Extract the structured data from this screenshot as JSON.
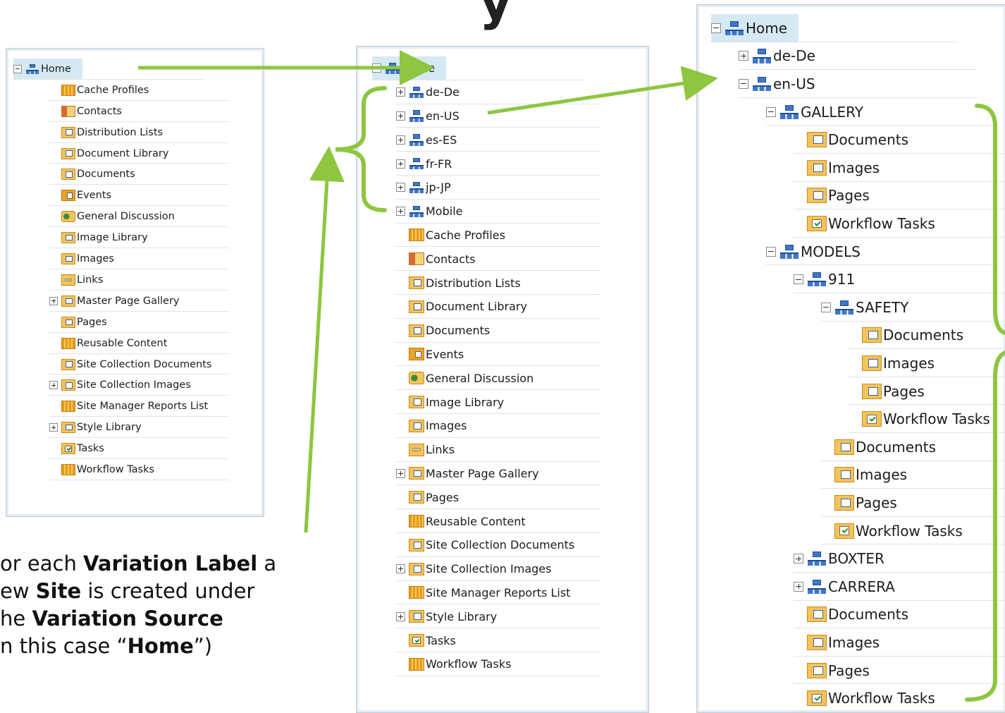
{
  "panel1": {
    "items": [
      {
        "label": "Home",
        "toggle": "minus",
        "icon": "site",
        "depth": 0,
        "selected": true
      },
      {
        "label": "Cache Profiles",
        "toggle": "none",
        "icon": "list",
        "depth": 1
      },
      {
        "label": "Contacts",
        "toggle": "none",
        "icon": "contacts",
        "depth": 1
      },
      {
        "label": "Distribution Lists",
        "toggle": "none",
        "icon": "doc",
        "depth": 1
      },
      {
        "label": "Document Library",
        "toggle": "none",
        "icon": "doc",
        "depth": 1
      },
      {
        "label": "Documents",
        "toggle": "none",
        "icon": "doc",
        "depth": 1
      },
      {
        "label": "Events",
        "toggle": "none",
        "icon": "events",
        "depth": 1
      },
      {
        "label": "General Discussion",
        "toggle": "none",
        "icon": "disc",
        "depth": 1
      },
      {
        "label": "Image Library",
        "toggle": "none",
        "icon": "doc",
        "depth": 1
      },
      {
        "label": "Images",
        "toggle": "none",
        "icon": "doc",
        "depth": 1
      },
      {
        "label": "Links",
        "toggle": "none",
        "icon": "links",
        "depth": 1
      },
      {
        "label": "Master Page Gallery",
        "toggle": "plus",
        "icon": "doc",
        "depth": 1
      },
      {
        "label": "Pages",
        "toggle": "none",
        "icon": "doc",
        "depth": 1
      },
      {
        "label": "Reusable Content",
        "toggle": "none",
        "icon": "list",
        "depth": 1
      },
      {
        "label": "Site Collection Documents",
        "toggle": "none",
        "icon": "doc",
        "depth": 1
      },
      {
        "label": "Site Collection Images",
        "toggle": "plus",
        "icon": "doc",
        "depth": 1
      },
      {
        "label": "Site Manager Reports List",
        "toggle": "none",
        "icon": "list",
        "depth": 1
      },
      {
        "label": "Style Library",
        "toggle": "plus",
        "icon": "doc",
        "depth": 1
      },
      {
        "label": "Tasks",
        "toggle": "none",
        "icon": "task",
        "depth": 1
      },
      {
        "label": "Workflow Tasks",
        "toggle": "none",
        "icon": "list",
        "depth": 1
      }
    ]
  },
  "panel2": {
    "items": [
      {
        "label": "Home",
        "toggle": "minus",
        "icon": "site",
        "depth": 0,
        "selected": true
      },
      {
        "label": "de-De",
        "toggle": "plus",
        "icon": "site",
        "depth": 1
      },
      {
        "label": "en-US",
        "toggle": "plus",
        "icon": "site",
        "depth": 1
      },
      {
        "label": "es-ES",
        "toggle": "plus",
        "icon": "site",
        "depth": 1
      },
      {
        "label": "fr-FR",
        "toggle": "plus",
        "icon": "site",
        "depth": 1
      },
      {
        "label": "jp-JP",
        "toggle": "plus",
        "icon": "site",
        "depth": 1
      },
      {
        "label": "Mobile",
        "toggle": "plus",
        "icon": "site",
        "depth": 1
      },
      {
        "label": "Cache Profiles",
        "toggle": "none",
        "icon": "list",
        "depth": 1
      },
      {
        "label": "Contacts",
        "toggle": "none",
        "icon": "contacts",
        "depth": 1
      },
      {
        "label": "Distribution Lists",
        "toggle": "none",
        "icon": "doc",
        "depth": 1
      },
      {
        "label": "Document Library",
        "toggle": "none",
        "icon": "doc",
        "depth": 1
      },
      {
        "label": "Documents",
        "toggle": "none",
        "icon": "doc",
        "depth": 1
      },
      {
        "label": "Events",
        "toggle": "none",
        "icon": "events",
        "depth": 1
      },
      {
        "label": "General Discussion",
        "toggle": "none",
        "icon": "disc",
        "depth": 1
      },
      {
        "label": "Image Library",
        "toggle": "none",
        "icon": "doc",
        "depth": 1
      },
      {
        "label": "Images",
        "toggle": "none",
        "icon": "doc",
        "depth": 1
      },
      {
        "label": "Links",
        "toggle": "none",
        "icon": "links",
        "depth": 1
      },
      {
        "label": "Master Page Gallery",
        "toggle": "plus",
        "icon": "doc",
        "depth": 1
      },
      {
        "label": "Pages",
        "toggle": "none",
        "icon": "doc",
        "depth": 1
      },
      {
        "label": "Reusable Content",
        "toggle": "none",
        "icon": "list",
        "depth": 1
      },
      {
        "label": "Site Collection Documents",
        "toggle": "none",
        "icon": "doc",
        "depth": 1
      },
      {
        "label": "Site Collection Images",
        "toggle": "plus",
        "icon": "doc",
        "depth": 1
      },
      {
        "label": "Site Manager Reports List",
        "toggle": "none",
        "icon": "list",
        "depth": 1
      },
      {
        "label": "Style Library",
        "toggle": "plus",
        "icon": "doc",
        "depth": 1
      },
      {
        "label": "Tasks",
        "toggle": "none",
        "icon": "task",
        "depth": 1
      },
      {
        "label": "Workflow Tasks",
        "toggle": "none",
        "icon": "list",
        "depth": 1
      }
    ]
  },
  "panel3": {
    "items": [
      {
        "label": "Home",
        "toggle": "minus",
        "icon": "site",
        "depth": 0,
        "selected": true
      },
      {
        "label": "de-De",
        "toggle": "plus",
        "icon": "site",
        "depth": 1
      },
      {
        "label": "en-US",
        "toggle": "minus",
        "icon": "site",
        "depth": 1
      },
      {
        "label": "GALLERY",
        "toggle": "minus",
        "icon": "site",
        "depth": 2
      },
      {
        "label": "Documents",
        "toggle": "none",
        "icon": "doc",
        "depth": 3
      },
      {
        "label": "Images",
        "toggle": "none",
        "icon": "doc",
        "depth": 3
      },
      {
        "label": "Pages",
        "toggle": "none",
        "icon": "doc",
        "depth": 3
      },
      {
        "label": "Workflow Tasks",
        "toggle": "none",
        "icon": "task",
        "depth": 3
      },
      {
        "label": "MODELS",
        "toggle": "minus",
        "icon": "site",
        "depth": 2
      },
      {
        "label": "911",
        "toggle": "minus",
        "icon": "site",
        "depth": 3
      },
      {
        "label": "SAFETY",
        "toggle": "minus",
        "icon": "site",
        "depth": 4
      },
      {
        "label": "Documents",
        "toggle": "none",
        "icon": "doc",
        "depth": 5
      },
      {
        "label": "Images",
        "toggle": "none",
        "icon": "doc",
        "depth": 5
      },
      {
        "label": "Pages",
        "toggle": "none",
        "icon": "doc",
        "depth": 5
      },
      {
        "label": "Workflow Tasks",
        "toggle": "none",
        "icon": "task",
        "depth": 5
      },
      {
        "label": "Documents",
        "toggle": "none",
        "icon": "doc",
        "depth": 4
      },
      {
        "label": "Images",
        "toggle": "none",
        "icon": "doc",
        "depth": 4
      },
      {
        "label": "Pages",
        "toggle": "none",
        "icon": "doc",
        "depth": 4
      },
      {
        "label": "Workflow Tasks",
        "toggle": "none",
        "icon": "task",
        "depth": 4
      },
      {
        "label": "BOXTER",
        "toggle": "plus",
        "icon": "site",
        "depth": 3
      },
      {
        "label": "CARRERA",
        "toggle": "plus",
        "icon": "site",
        "depth": 3
      },
      {
        "label": "Documents",
        "toggle": "none",
        "icon": "doc",
        "depth": 3
      },
      {
        "label": "Images",
        "toggle": "none",
        "icon": "doc",
        "depth": 3
      },
      {
        "label": "Pages",
        "toggle": "none",
        "icon": "doc",
        "depth": 3
      },
      {
        "label": "Workflow Tasks",
        "toggle": "none",
        "icon": "task",
        "depth": 3
      }
    ]
  },
  "callout": {
    "line1_a": "or each ",
    "line1_b": "Variation Label",
    "line1_c": " a",
    "line2_a": "ew ",
    "line2_b": "Site",
    "line2_c": " is created under",
    "line3_a": "he ",
    "line3_b": "Variation Source",
    "line4_a": "n this case “",
    "line4_b": "Home",
    "line4_c": "”)"
  },
  "colors": {
    "accent_green": "#8dc63f",
    "selected_bg": "#d6e9f3",
    "panel_border": "#bfcbd8"
  }
}
